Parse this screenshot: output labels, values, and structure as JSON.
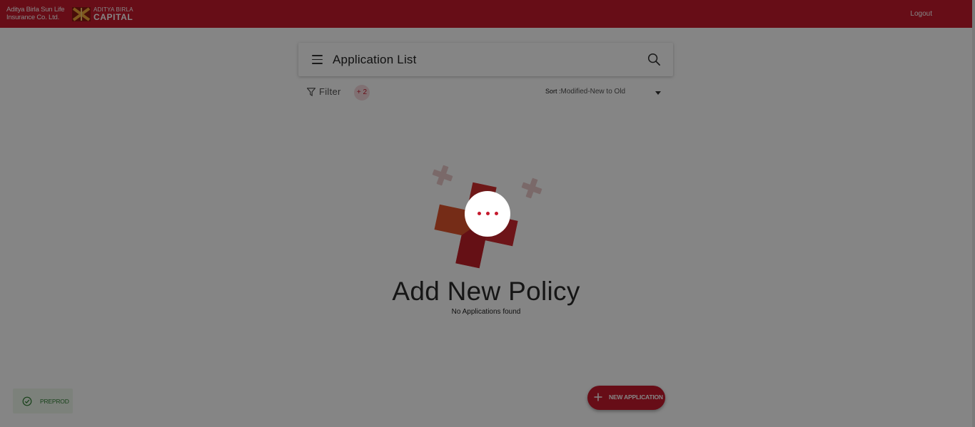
{
  "header": {
    "brand_line1": "Aditya Birla Sun Life",
    "brand_line2": "Insurance Co. Ltd.",
    "capital_line1": "ADITYA BIRLA",
    "capital_line2": "CAPITAL",
    "logout_label": "Logout",
    "brand_color": "#c5192d"
  },
  "appbar": {
    "title": "Application List",
    "menu_icon": "hamburger-menu-icon",
    "search_icon": "search-icon"
  },
  "filter": {
    "label": "Filter",
    "count": "+ 2",
    "icon": "funnel-icon"
  },
  "sort": {
    "label": "Sort :",
    "value": "Modified-New to Old"
  },
  "empty_state": {
    "title": "Add New Policy",
    "subtitle": "No Applications found",
    "illustration": "red-cross-illustration"
  },
  "fab": {
    "label": "NEW APPLICATION",
    "icon": "plus-icon"
  },
  "environment": {
    "label": "PREPROD",
    "icon": "check-circle-icon",
    "color": "#2e7d32"
  },
  "loading": {
    "visible": true,
    "icon": "loading-dots-icon"
  }
}
